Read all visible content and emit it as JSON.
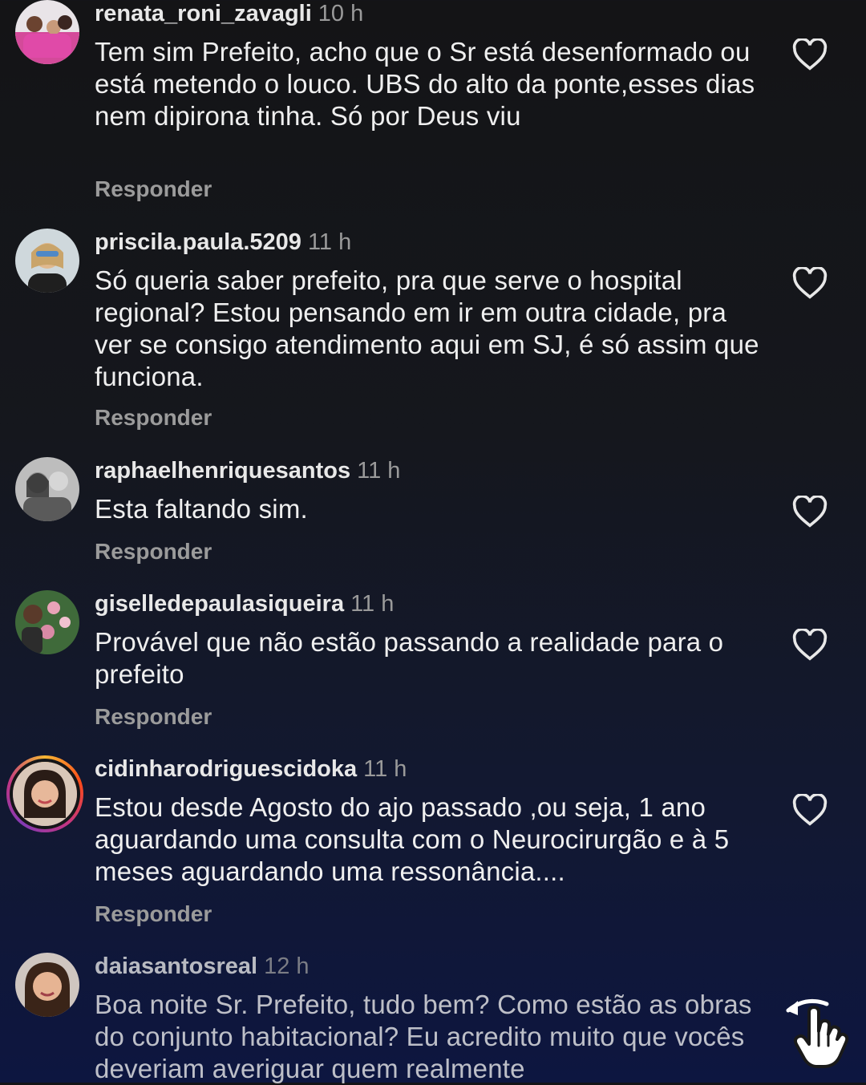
{
  "comments": [
    {
      "username": "renata_roni_zavagli",
      "time": "10 h",
      "text": "Tem sim Prefeito, acho que o Sr está desenformado ou está metendo o louco. UBS do alto da ponte,esses dias nem dipirona tinha. Só por Deus viu",
      "reply_label": "Responder"
    },
    {
      "username": "priscila.paula.5209",
      "time": "11 h",
      "text": "Só queria saber prefeito, pra que serve o hospital regional? Estou pensando em ir em outra cidade, pra ver se consigo atendimento aqui em SJ, é só assim que funciona.",
      "reply_label": "Responder"
    },
    {
      "username": "raphaelhenriquesantos",
      "time": "11 h",
      "text": "Esta faltando sim.",
      "reply_label": "Responder"
    },
    {
      "username": "giselledepaulasiqueira",
      "time": "11 h",
      "text": "Provável que não estão passando a realidade para o prefeito",
      "reply_label": "Responder"
    },
    {
      "username": "cidinharodriguescidoka",
      "time": "11 h",
      "text": "Estou desde Agosto do ajo passado ,ou seja, 1 ano aguardando uma consulta com o Neurocirurgão e à 5 meses aguardando uma ressonância....",
      "reply_label": "Responder"
    },
    {
      "username": "daiasantosreal",
      "time": "12 h",
      "text": "Boa noite Sr. Prefeito, tudo bem? Como estão as obras do conjunto habitacional? Eu acredito muito que vocês deveriam averiguar quem realmente",
      "reply_label": ""
    }
  ],
  "icons": {
    "like": "heart-outline-icon",
    "swipe": "hand-swipe-icon"
  }
}
